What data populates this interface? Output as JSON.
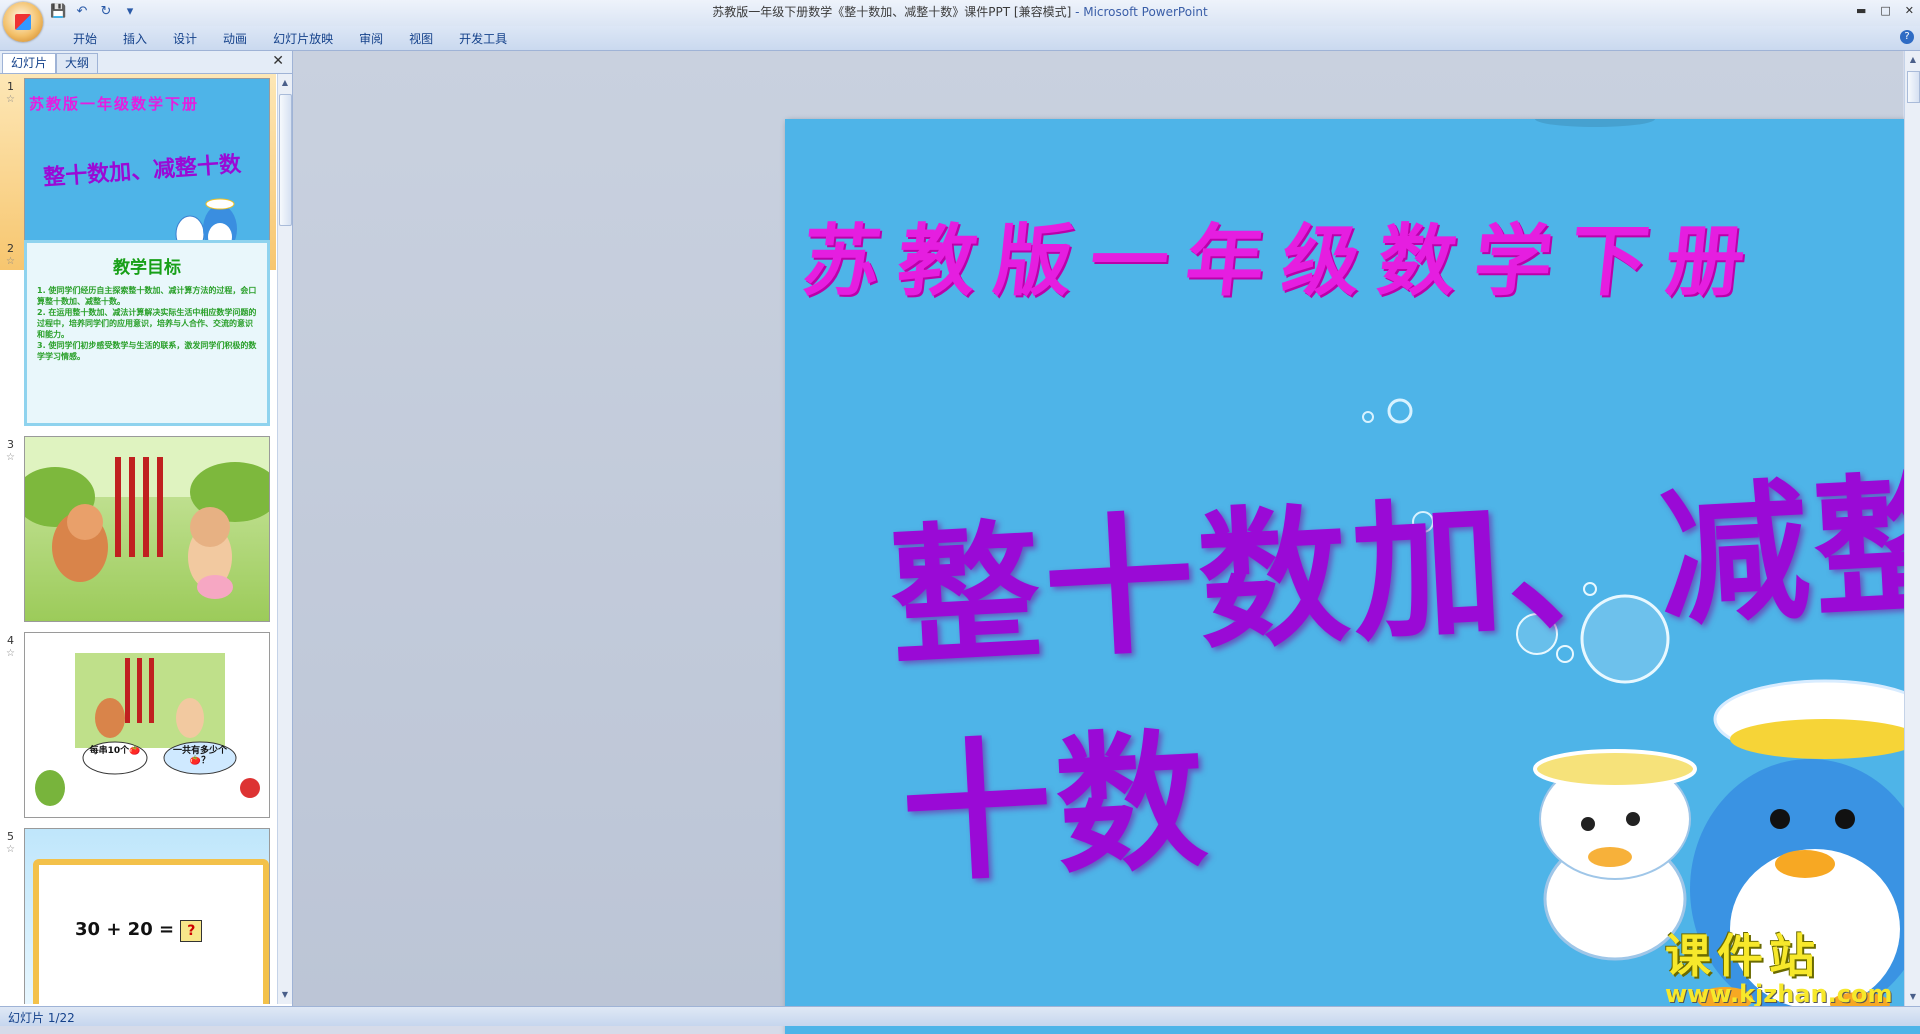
{
  "window": {
    "title": "苏教版一年级下册数学《整十数加、减整十数》课件PPT [兼容模式]",
    "app_name": " - Microsoft PowerPoint"
  },
  "ribbon": {
    "tabs": [
      "开始",
      "插入",
      "设计",
      "动画",
      "幻灯片放映",
      "审阅",
      "视图",
      "开发工具"
    ]
  },
  "panel": {
    "tab_slides": "幻灯片",
    "tab_outline": "大纲",
    "thumbnails": [
      {
        "num": "1",
        "title": "苏教版一年级数学下册",
        "subtitle": "整十数加、减整十数"
      },
      {
        "num": "2",
        "heading": "教学目标",
        "items": [
          "1. 使同学们经历自主探索整十数加、减计算方法的过程，会口算整十数加、减整十数。",
          "2. 在运用整十数加、减法计算解决实际生活中相应数学问题的过程中，培养同学们的应用意识，培养与人合作、交流的意识和能力。",
          "3. 使同学们初步感受数学与生活的联系，激发同学们积极的数学学习情感。"
        ]
      },
      {
        "num": "3"
      },
      {
        "num": "4",
        "bubble_left": "每串10个🍅",
        "bubble_right": "一共有多少个🍅？"
      },
      {
        "num": "5",
        "equation": "30 + 20 =",
        "answer": "?"
      }
    ]
  },
  "slide": {
    "title": "苏教版一年级数学下册",
    "main_title": "整十数加、减整十数"
  },
  "status": {
    "slide_indicator": "幻灯片 1/22"
  },
  "watermark": {
    "cn": "课件站",
    "url": "www.kjzhan.com"
  },
  "colors": {
    "slide_bg": "#4eb4e8",
    "title_color": "#e51ee0",
    "main_title_color": "#9a0ad6"
  }
}
